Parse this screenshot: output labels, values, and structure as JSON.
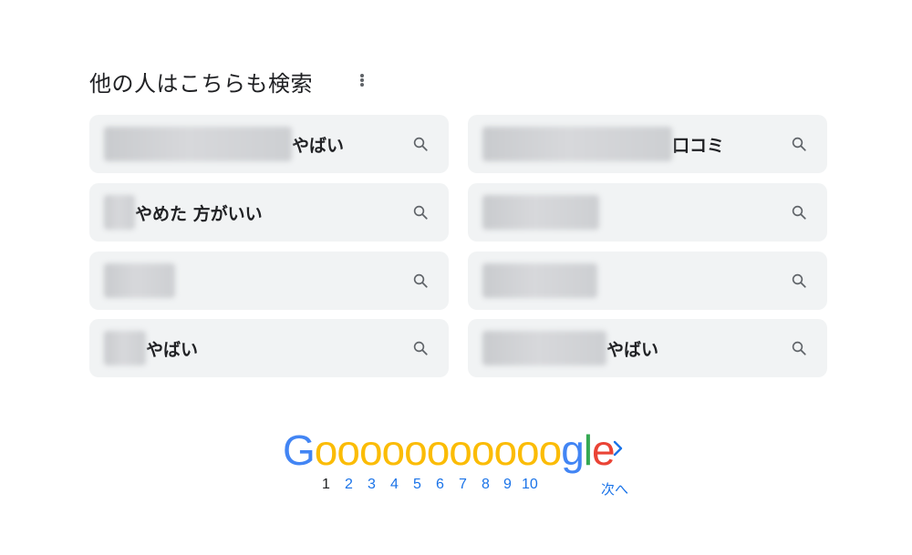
{
  "section": {
    "title": "他の人はこちらも検索",
    "more_icon": "more-vert-icon"
  },
  "related_searches": [
    {
      "suffix": "やばい"
    },
    {
      "suffix": "口コミ"
    },
    {
      "suffix": "やめた 方がいい"
    },
    {
      "suffix": ""
    },
    {
      "suffix": ""
    },
    {
      "suffix": ""
    },
    {
      "suffix": "やばい"
    },
    {
      "suffix": "やばい"
    }
  ],
  "chip_icon": "search-icon",
  "pagination": {
    "logo": {
      "g1": "G",
      "o": "ooooooooooo",
      "g2": "g",
      "l": "l",
      "e": "e"
    },
    "pages": [
      "1",
      "2",
      "3",
      "4",
      "5",
      "6",
      "7",
      "8",
      "9",
      "10"
    ],
    "current": "1",
    "next_label": "次へ",
    "next_icon": "chevron-right-icon"
  },
  "colors": {
    "blue": "#4285f4",
    "yellow": "#fbbc05",
    "green": "#34a853",
    "red": "#ea4335",
    "link": "#1a73e8",
    "chip_bg": "#f1f3f4"
  }
}
